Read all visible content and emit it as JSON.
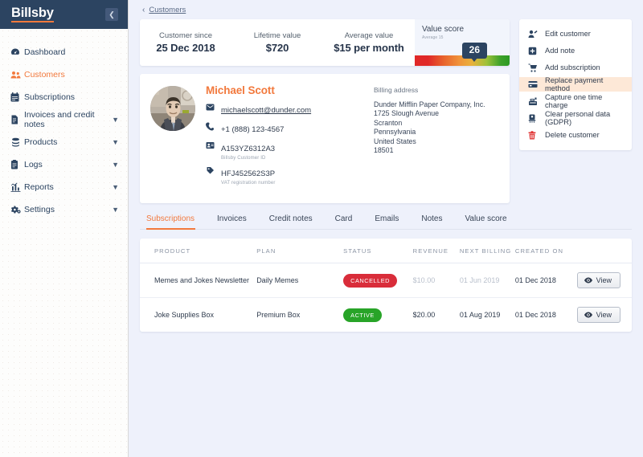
{
  "sidebar": {
    "logo": "Billsby",
    "collapse_icon": "chevron-left-icon",
    "items": [
      {
        "label": "Dashboard",
        "icon": "speedometer-icon",
        "active": false,
        "caret": false
      },
      {
        "label": "Customers",
        "icon": "people-icon",
        "active": true,
        "caret": false
      },
      {
        "label": "Subscriptions",
        "icon": "calendar-icon",
        "active": false,
        "caret": false
      },
      {
        "label": "Invoices and credit notes",
        "icon": "invoice-icon",
        "active": false,
        "caret": true
      },
      {
        "label": "Products",
        "icon": "products-icon",
        "active": false,
        "caret": true
      },
      {
        "label": "Logs",
        "icon": "clipboard-icon",
        "active": false,
        "caret": true
      },
      {
        "label": "Reports",
        "icon": "bar-chart-icon",
        "active": false,
        "caret": true
      },
      {
        "label": "Settings",
        "icon": "gear-icon",
        "active": false,
        "caret": true
      }
    ]
  },
  "breadcrumb": {
    "arrow": "‹",
    "link": "Customers"
  },
  "metrics": [
    {
      "label": "Customer since",
      "value": "25 Dec 2018"
    },
    {
      "label": "Lifetime value",
      "value": "$720"
    },
    {
      "label": "Average value",
      "value": "$15 per month"
    }
  ],
  "value_score": {
    "title": "Value score",
    "subtitle": "Average 15",
    "score": "26"
  },
  "customer": {
    "name": "Michael Scott",
    "avatar_alt": "customer-avatar",
    "fields": [
      {
        "icon": "envelope-icon",
        "value": "michaelscott@dunder.com",
        "sub": "",
        "link": true
      },
      {
        "icon": "phone-icon",
        "value": "+1 (888) 123-4567",
        "sub": "",
        "link": false
      },
      {
        "icon": "id-card-icon",
        "value": "A153YZ6312A3",
        "sub": "Billsby Customer ID",
        "link": false
      },
      {
        "icon": "tag-icon",
        "value": "HFJ452562S3P",
        "sub": "VAT registration number",
        "link": false
      }
    ],
    "billing_title": "Billing address",
    "billing_lines": [
      "Dunder Mifflin Paper Company, Inc.",
      "1725 Slough Avenue",
      "Scranton",
      "Pennsylvania",
      "United States",
      "18501"
    ]
  },
  "actions": [
    {
      "label": "Edit customer",
      "icon": "user-edit-icon",
      "highlight": false,
      "danger": false
    },
    {
      "label": "Add note",
      "icon": "note-plus-icon",
      "highlight": false,
      "danger": false
    },
    {
      "label": "Add subscription",
      "icon": "cart-icon",
      "highlight": false,
      "danger": false
    },
    {
      "label": "Replace payment method",
      "icon": "credit-card-icon",
      "highlight": true,
      "danger": false
    },
    {
      "label": "Capture one time charge",
      "icon": "cash-register-icon",
      "highlight": false,
      "danger": false
    },
    {
      "label": "Clear personal data (GDPR)",
      "icon": "shredder-icon",
      "highlight": false,
      "danger": false
    },
    {
      "label": "Delete customer",
      "icon": "trash-icon",
      "highlight": false,
      "danger": true
    }
  ],
  "tabs": [
    {
      "label": "Subscriptions",
      "active": true
    },
    {
      "label": "Invoices",
      "active": false
    },
    {
      "label": "Credit notes",
      "active": false
    },
    {
      "label": "Card",
      "active": false
    },
    {
      "label": "Emails",
      "active": false
    },
    {
      "label": "Notes",
      "active": false
    },
    {
      "label": "Value score",
      "active": false
    }
  ],
  "table": {
    "columns": [
      "PRODUCT",
      "PLAN",
      "STATUS",
      "REVENUE",
      "NEXT BILLING",
      "CREATED ON",
      ""
    ],
    "view_label": "View",
    "rows": [
      {
        "product": "Memes and Jokes Newsletter",
        "plan": "Daily Memes",
        "status": "CANCELLED",
        "status_kind": "cancelled",
        "revenue": "$10.00",
        "next_billing": "01 Jun 2019",
        "created_on": "01 Dec 2018",
        "dimmed": true
      },
      {
        "product": "Joke Supplies Box",
        "plan": "Premium Box",
        "status": "ACTIVE",
        "status_kind": "active",
        "revenue": "$20.00",
        "next_billing": "01 Aug 2019",
        "created_on": "01 Dec 2018",
        "dimmed": false
      }
    ]
  },
  "colors": {
    "brand_navy": "#2c4461",
    "accent_orange": "#f2793d",
    "page_bg": "#eef1fb",
    "status_cancelled": "#d92d3a",
    "status_active": "#28a428",
    "highlight_bg": "#fde8d7"
  }
}
